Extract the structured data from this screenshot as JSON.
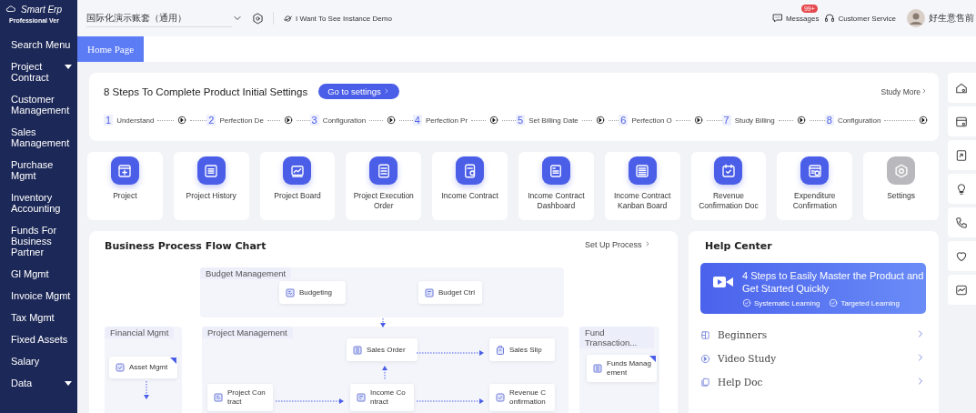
{
  "brand": {
    "name": "Smart Erp",
    "edition": "Professional Ver"
  },
  "sidebar": {
    "items": [
      {
        "label": "Search Menu",
        "has_submenu": false
      },
      {
        "label": "Project Contract",
        "has_submenu": true
      },
      {
        "label": "Customer Management",
        "has_submenu": false
      },
      {
        "label": "Sales Management",
        "has_submenu": false
      },
      {
        "label": "Purchase Mgmt",
        "has_submenu": false
      },
      {
        "label": "Inventory Accounting",
        "has_submenu": false
      },
      {
        "label": "Funds For Business Partner",
        "has_submenu": false
      },
      {
        "label": "Gl Mgmt",
        "has_submenu": false
      },
      {
        "label": "Invoice Mgmt",
        "has_submenu": false
      },
      {
        "label": "Tax Mgmt",
        "has_submenu": false
      },
      {
        "label": "Fixed Assets",
        "has_submenu": false
      },
      {
        "label": "Salary",
        "has_submenu": false
      },
      {
        "label": "Data",
        "has_submenu": true
      }
    ]
  },
  "topbar": {
    "account": "国际化演示账套（通用）",
    "demo_link": "I Want To See Instance Demo",
    "messages": "Messages",
    "messages_badge": "99+",
    "service": "Customer Service",
    "user": "好生意售前"
  },
  "tabs": [
    {
      "label": "Home Page",
      "selected": true
    }
  ],
  "setup": {
    "title": "8 Steps To Complete Product Initial Settings",
    "button": "Go to settings",
    "more": "Study More",
    "steps": [
      {
        "number": "1",
        "label": "Understand"
      },
      {
        "number": "2",
        "label": "Perfection De"
      },
      {
        "number": "3",
        "label": "Configuration"
      },
      {
        "number": "4",
        "label": "Perfection Pr"
      },
      {
        "number": "5",
        "label": "Set Billing Date"
      },
      {
        "number": "6",
        "label": "Perfection O"
      },
      {
        "number": "7",
        "label": "Study Billing"
      },
      {
        "number": "8",
        "label": "Configuration"
      }
    ]
  },
  "shortcuts": [
    {
      "label": "Project",
      "kind": "app"
    },
    {
      "label": "Project History",
      "kind": "app"
    },
    {
      "label": "Project Board",
      "kind": "app"
    },
    {
      "label": "Project Execution Order",
      "kind": "app"
    },
    {
      "label": "Income Contract",
      "kind": "app"
    },
    {
      "label": "Income Contract Dashboard",
      "kind": "app"
    },
    {
      "label": "Income Contract Kanban Board",
      "kind": "app"
    },
    {
      "label": "Revenue Confirmation Doc",
      "kind": "app"
    },
    {
      "label": "Expenditure Confirmation",
      "kind": "app"
    },
    {
      "label": "Settings",
      "kind": "settings"
    }
  ],
  "flow_chart": {
    "title": "Business Process Flow Chart",
    "action": "Set Up Process",
    "groups": [
      {
        "label": "Budget Management"
      },
      {
        "label": "Financial Mgmt"
      },
      {
        "label": "Project Management"
      },
      {
        "label": "Fund Transaction..."
      }
    ],
    "nodes": [
      {
        "label": "Budgeting",
        "flagged": false
      },
      {
        "label": "Budget Ctrl",
        "flagged": false
      },
      {
        "label": "Asset Mgmt",
        "flagged": true
      },
      {
        "label": "Sales Order",
        "flagged": false
      },
      {
        "label": "Sales Slip",
        "flagged": false
      },
      {
        "label": "Project Contract",
        "flagged": false
      },
      {
        "label": "Income Contract",
        "flagged": false
      },
      {
        "label": "Revenue Confirmation",
        "flagged": false
      },
      {
        "label": "Funds Management",
        "flagged": true
      }
    ]
  },
  "help_center": {
    "title": "Help Center",
    "banner": {
      "title": "4 Steps to Easily Master the Product and Get Started Quickly",
      "tags": [
        "Systematic Learning",
        "Targeted Learning"
      ]
    },
    "links": [
      "Beginners",
      "Video Study",
      "Help Doc"
    ]
  }
}
